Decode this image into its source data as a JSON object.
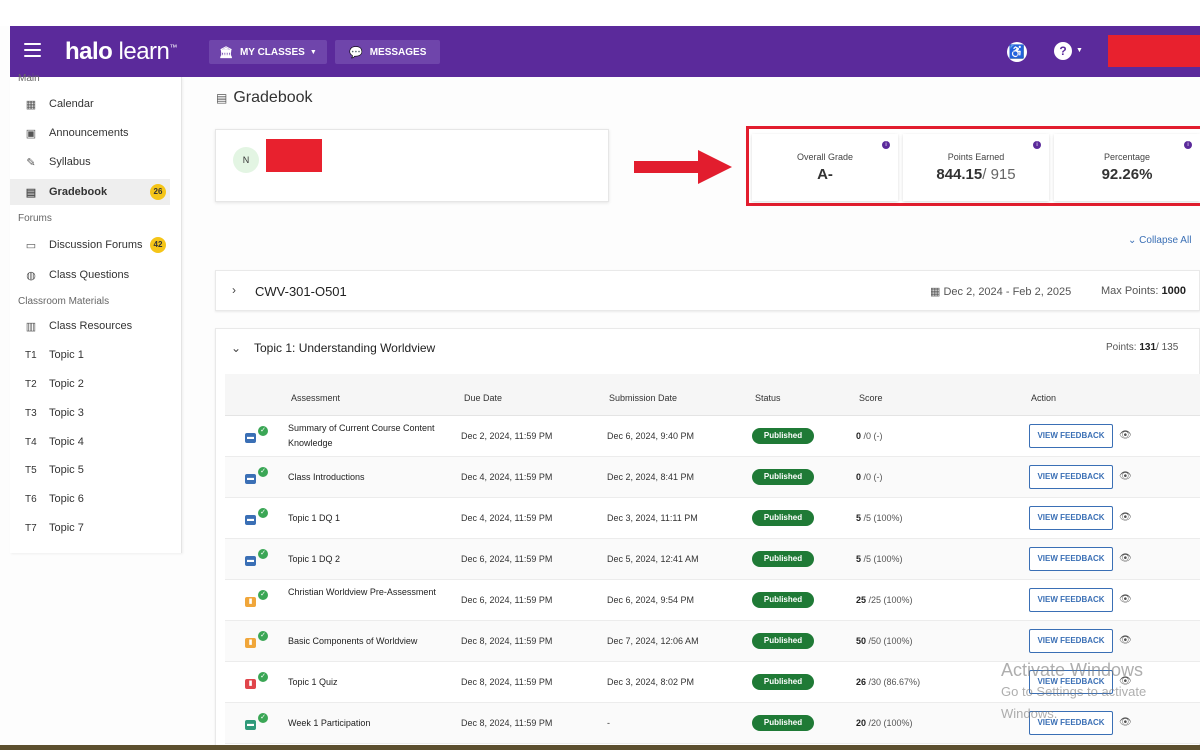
{
  "topbar": {
    "logo_bold": "halo",
    "logo_light": "learn",
    "logo_tm": "™",
    "my_classes": "MY CLASSES",
    "messages": "MESSAGES",
    "help": "?",
    "accessibility": "♿"
  },
  "sidebar": {
    "section_main": "Main",
    "section_forums": "Forums",
    "section_materials": "Classroom Materials",
    "items": [
      {
        "label": "Calendar",
        "icon": "calendar-icon"
      },
      {
        "label": "Announcements",
        "icon": "announcement-icon"
      },
      {
        "label": "Syllabus",
        "icon": "syllabus-icon"
      },
      {
        "label": "Gradebook",
        "icon": "gradebook-icon",
        "badge": "26"
      },
      {
        "label": "Discussion Forums",
        "icon": "forum-icon",
        "badge": "42"
      },
      {
        "label": "Class Questions",
        "icon": "question-icon"
      },
      {
        "label": "Class Resources",
        "icon": "resources-icon"
      }
    ],
    "topics": [
      {
        "code": "T1",
        "label": "Topic 1"
      },
      {
        "code": "T2",
        "label": "Topic 2"
      },
      {
        "code": "T3",
        "label": "Topic 3"
      },
      {
        "code": "T4",
        "label": "Topic 4"
      },
      {
        "code": "T5",
        "label": "Topic 5"
      },
      {
        "code": "T6",
        "label": "Topic 6"
      },
      {
        "code": "T7",
        "label": "Topic 7"
      }
    ]
  },
  "page": {
    "title": "Gradebook",
    "student_initial": "N",
    "collapse_all": "Collapse All"
  },
  "grades": {
    "overall_label": "Overall Grade",
    "overall_value": "A-",
    "points_label": "Points Earned",
    "points_value": "844.15",
    "points_total": "/ 915",
    "percentage_label": "Percentage",
    "percentage_value": "92.26%"
  },
  "course": {
    "code": "CWV-301-O501",
    "dates": "Dec 2, 2024 - Feb 2, 2025",
    "max_points_label": "Max Points:",
    "max_points_value": "1000"
  },
  "topic": {
    "title": "Topic 1: Understanding Worldview",
    "points_label": "Points:",
    "points_value": "131",
    "points_total": "/ 135"
  },
  "table": {
    "headers": [
      "Assessment",
      "Due Date",
      "Submission Date",
      "Status",
      "Score",
      "Action"
    ],
    "rows": [
      {
        "icon": "chat",
        "name": "Summary of Current Course Content Knowledge",
        "due": "Dec 2, 2024, 11:59 PM",
        "submitted": "Dec 6, 2024, 9:40 PM",
        "status": "Published",
        "score": "0",
        "score_rest": "/0 (-)",
        "action": "VIEW FEEDBACK"
      },
      {
        "icon": "chat",
        "name": "Class Introductions",
        "due": "Dec 4, 2024, 11:59 PM",
        "submitted": "Dec 2, 2024, 8:41 PM",
        "status": "Published",
        "score": "0",
        "score_rest": "/0 (-)",
        "action": "VIEW FEEDBACK"
      },
      {
        "icon": "chat",
        "name": "Topic 1 DQ 1",
        "due": "Dec 4, 2024, 11:59 PM",
        "submitted": "Dec 3, 2024, 11:11 PM",
        "status": "Published",
        "score": "5",
        "score_rest": "/5 (100%)",
        "action": "VIEW FEEDBACK"
      },
      {
        "icon": "chat",
        "name": "Topic 1 DQ 2",
        "due": "Dec 6, 2024, 11:59 PM",
        "submitted": "Dec 5, 2024, 12:41 AM",
        "status": "Published",
        "score": "5",
        "score_rest": "/5 (100%)",
        "action": "VIEW FEEDBACK"
      },
      {
        "icon": "assignment",
        "name": "Christian Worldview Pre-Assessment",
        "due": "Dec 6, 2024, 11:59 PM",
        "submitted": "Dec 6, 2024, 9:54 PM",
        "status": "Published",
        "score": "25",
        "score_rest": "/25 (100%)",
        "action": "VIEW FEEDBACK"
      },
      {
        "icon": "assignment",
        "name": "Basic Components of Worldview",
        "due": "Dec 8, 2024, 11:59 PM",
        "submitted": "Dec 7, 2024, 12:06 AM",
        "status": "Published",
        "score": "50",
        "score_rest": "/50 (100%)",
        "action": "VIEW FEEDBACK"
      },
      {
        "icon": "quiz",
        "name": "Topic 1 Quiz",
        "due": "Dec 8, 2024, 11:59 PM",
        "submitted": "Dec 3, 2024, 8:02 PM",
        "status": "Published",
        "score": "26",
        "score_rest": "/30 (86.67%)",
        "action": "VIEW FEEDBACK"
      },
      {
        "icon": "participation",
        "name": "Week 1 Participation",
        "due": "Dec 8, 2024, 11:59 PM",
        "submitted": "-",
        "status": "Published",
        "score": "20",
        "score_rest": "/20 (100%)",
        "action": "VIEW FEEDBACK"
      }
    ]
  },
  "watermark": {
    "line1": "Activate Windows",
    "line2": "Go to Settings to activate Windows."
  },
  "colors": {
    "brand_purple": "#5b2a9b",
    "published_green": "#1f7a36",
    "highlight_red": "#e21d2e",
    "link_blue": "#3a6fb5",
    "badge_yellow": "#f5c518"
  }
}
